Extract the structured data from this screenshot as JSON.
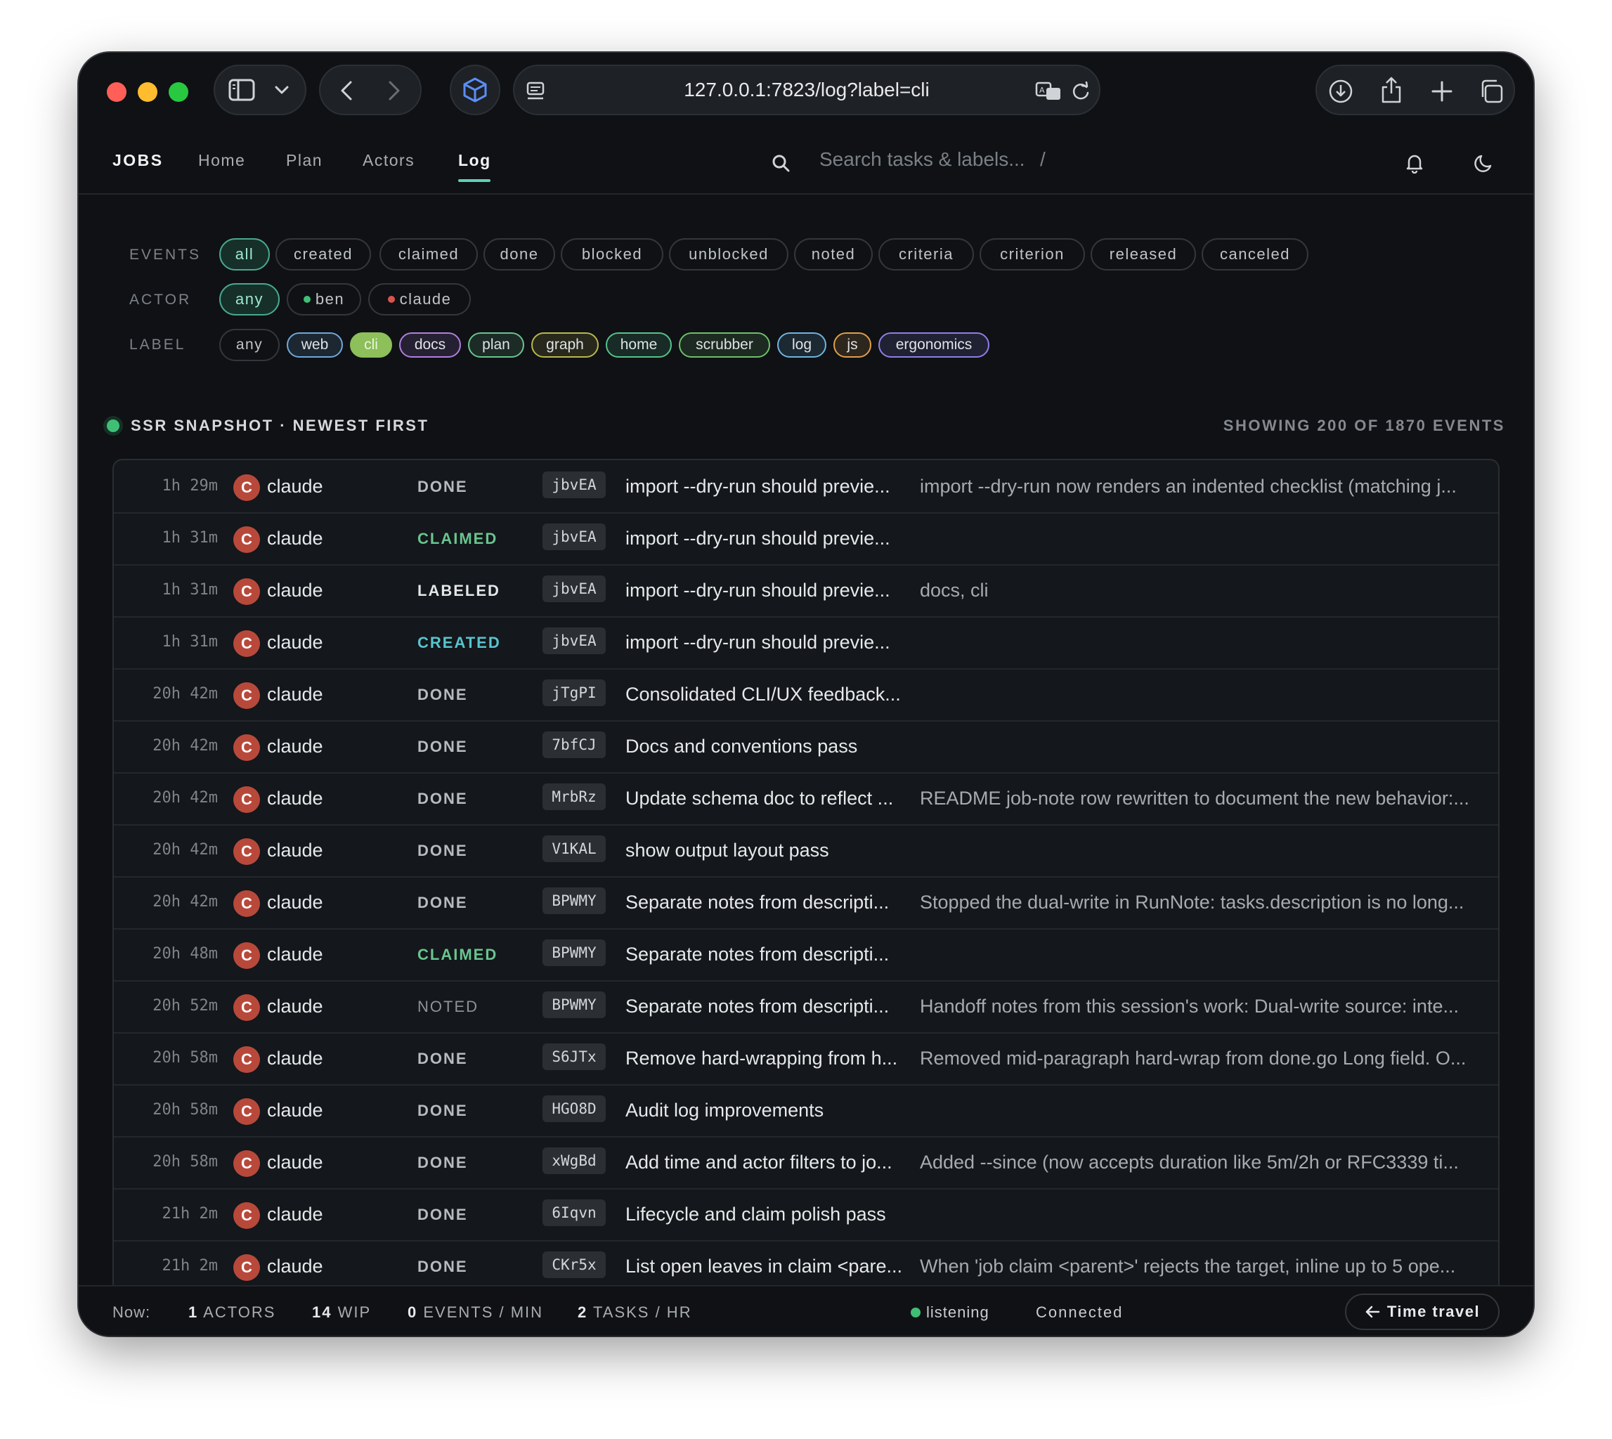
{
  "browser": {
    "url": "127.0.0.1:7823/log?label=cli",
    "colors": {
      "close": "#ff5f57",
      "minimize": "#febc2e",
      "zoom": "#28c840"
    }
  },
  "nav": {
    "brand": "JOBS",
    "links": [
      "Home",
      "Plan",
      "Actors",
      "Log"
    ],
    "active": "Log",
    "search_placeholder": "Search tasks & labels...",
    "search_shortcut": "/"
  },
  "filters": {
    "events_label": "EVENTS",
    "events": [
      "all",
      "created",
      "claimed",
      "done",
      "blocked",
      "unblocked",
      "noted",
      "criteria",
      "criterion",
      "released",
      "canceled"
    ],
    "events_selected": "all",
    "actor_label": "ACTOR",
    "actors": [
      {
        "name": "any",
        "dot": ""
      },
      {
        "name": "ben",
        "dot": "#3fbf76"
      },
      {
        "name": "claude",
        "dot": "#d9534f"
      }
    ],
    "actor_selected": "any",
    "label_label": "LABEL",
    "labels": [
      {
        "name": "any",
        "color": "#8a8f95"
      },
      {
        "name": "web",
        "color": "#6fa8dc"
      },
      {
        "name": "cli",
        "color": "#8dbf5a"
      },
      {
        "name": "docs",
        "color": "#b07fe0"
      },
      {
        "name": "plan",
        "color": "#6ac48f"
      },
      {
        "name": "graph",
        "color": "#b9b84a"
      },
      {
        "name": "home",
        "color": "#55c48a"
      },
      {
        "name": "scrubber",
        "color": "#6fbf6a"
      },
      {
        "name": "log",
        "color": "#6fb5e0"
      },
      {
        "name": "js",
        "color": "#e0a04a"
      },
      {
        "name": "ergonomics",
        "color": "#8f7fe8"
      }
    ],
    "label_selected": "cli"
  },
  "log": {
    "title": "SSR SNAPSHOT · NEWEST FIRST",
    "count": "SHOWING 200 OF 1870 EVENTS",
    "rows": [
      {
        "time": "1h 29m",
        "avatar": "C",
        "actor": "claude",
        "type": "DONE",
        "id": "jbvEA",
        "title": "import --dry-run should previe...",
        "note": "import --dry-run now renders an indented checklist (matching j..."
      },
      {
        "time": "1h 31m",
        "avatar": "C",
        "actor": "claude",
        "type": "CLAIMED",
        "id": "jbvEA",
        "title": "import --dry-run should previe...",
        "note": ""
      },
      {
        "time": "1h 31m",
        "avatar": "C",
        "actor": "claude",
        "type": "LABELED",
        "id": "jbvEA",
        "title": "import --dry-run should previe...",
        "note": "docs, cli"
      },
      {
        "time": "1h 31m",
        "avatar": "C",
        "actor": "claude",
        "type": "CREATED",
        "id": "jbvEA",
        "title": "import --dry-run should previe...",
        "note": ""
      },
      {
        "time": "20h 42m",
        "avatar": "C",
        "actor": "claude",
        "type": "DONE",
        "id": "jTgPI",
        "title": "Consolidated CLI/UX feedback...",
        "note": ""
      },
      {
        "time": "20h 42m",
        "avatar": "C",
        "actor": "claude",
        "type": "DONE",
        "id": "7bfCJ",
        "title": "Docs and conventions pass",
        "note": ""
      },
      {
        "time": "20h 42m",
        "avatar": "C",
        "actor": "claude",
        "type": "DONE",
        "id": "MrbRz",
        "title": "Update schema doc to reflect ...",
        "note": "README job-note row rewritten to document the new behavior:..."
      },
      {
        "time": "20h 42m",
        "avatar": "C",
        "actor": "claude",
        "type": "DONE",
        "id": "V1KAL",
        "title": "show output layout pass",
        "note": ""
      },
      {
        "time": "20h 42m",
        "avatar": "C",
        "actor": "claude",
        "type": "DONE",
        "id": "BPWMY",
        "title": "Separate notes from descripti...",
        "note": "Stopped the dual-write in RunNote: tasks.description is no long..."
      },
      {
        "time": "20h 48m",
        "avatar": "C",
        "actor": "claude",
        "type": "CLAIMED",
        "id": "BPWMY",
        "title": "Separate notes from descripti...",
        "note": ""
      },
      {
        "time": "20h 52m",
        "avatar": "C",
        "actor": "claude",
        "type": "NOTED",
        "id": "BPWMY",
        "title": "Separate notes from descripti...",
        "note": "Handoff notes from this session's work: Dual-write source: inte..."
      },
      {
        "time": "20h 58m",
        "avatar": "C",
        "actor": "claude",
        "type": "DONE",
        "id": "S6JTx",
        "title": "Remove hard-wrapping from h...",
        "note": "Removed mid-paragraph hard-wrap from done.go Long field. O..."
      },
      {
        "time": "20h 58m",
        "avatar": "C",
        "actor": "claude",
        "type": "DONE",
        "id": "HGO8D",
        "title": "Audit log improvements",
        "note": ""
      },
      {
        "time": "20h 58m",
        "avatar": "C",
        "actor": "claude",
        "type": "DONE",
        "id": "xWgBd",
        "title": "Add time and actor filters to jo...",
        "note": "Added --since (now accepts duration like 5m/2h or RFC3339 ti..."
      },
      {
        "time": "21h 2m",
        "avatar": "C",
        "actor": "claude",
        "type": "DONE",
        "id": "6Iqvn",
        "title": "Lifecycle and claim polish pass",
        "note": ""
      },
      {
        "time": "21h 2m",
        "avatar": "C",
        "actor": "claude",
        "type": "DONE",
        "id": "CKr5x",
        "title": "List open leaves in claim <pare...",
        "note": "When 'job claim <parent>' rejects the target, inline up to 5 ope..."
      }
    ]
  },
  "footer": {
    "now_label": "Now:",
    "actors_value": "1",
    "actors_label": "ACTORS",
    "wip_value": "14",
    "wip_label": "WIP",
    "events_value": "0",
    "events_label": "EVENTS / MIN",
    "tasks_value": "2",
    "tasks_label": "TASKS / HR",
    "listening": "listening",
    "connected": "Connected",
    "time_travel": "Time travel"
  }
}
